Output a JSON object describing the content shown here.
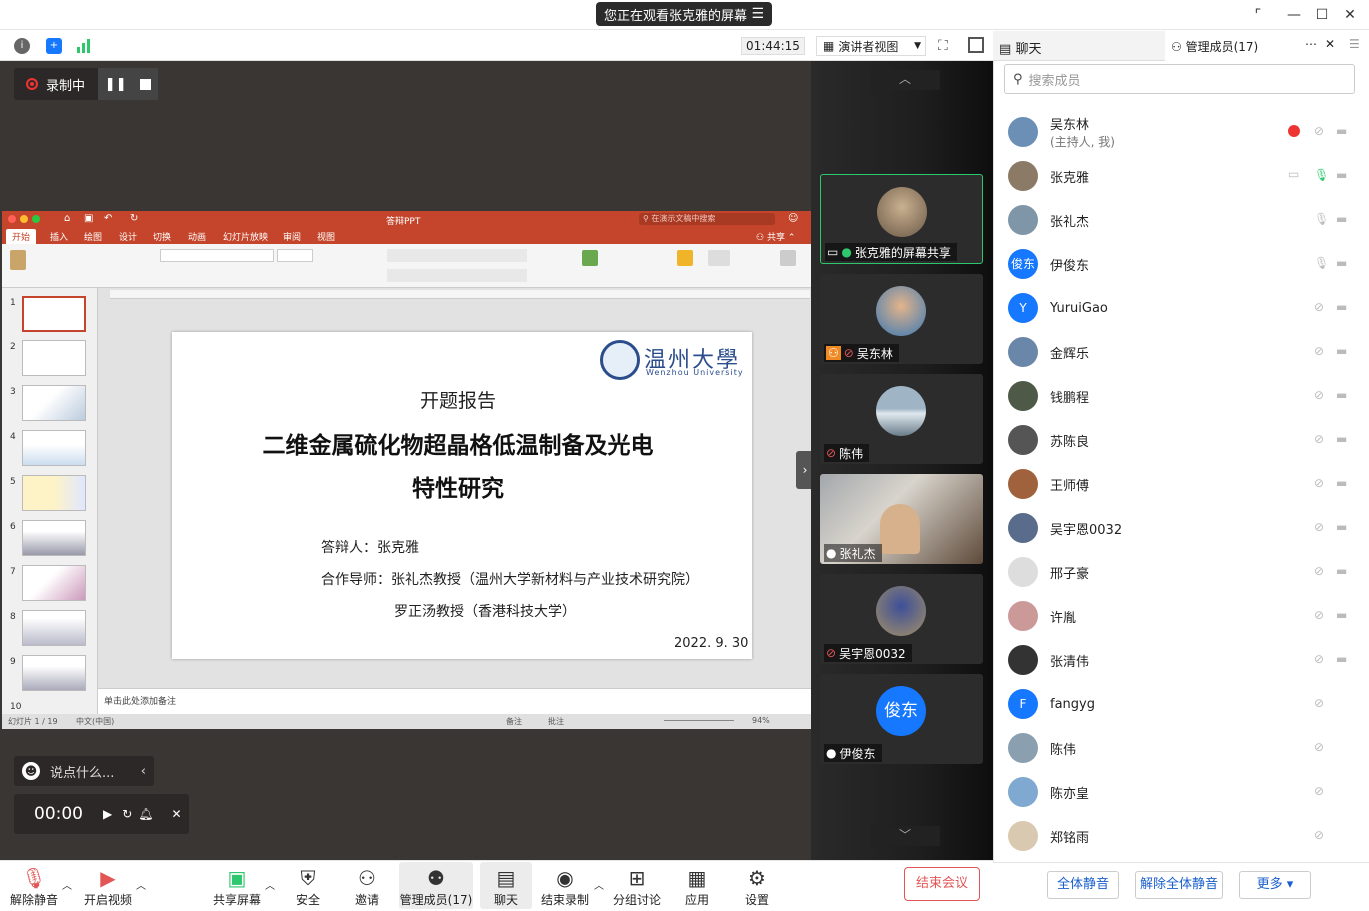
{
  "title_bar": {
    "share_banner": "您正在观看张克雅的屏幕"
  },
  "toolbar": {
    "timer": "01:44:15",
    "speaker_view": "演讲者视图"
  },
  "recording": {
    "label": "录制中"
  },
  "ppt": {
    "window_title": "答辩PPT",
    "search_placeholder": "在演示文稿中搜索",
    "tabs": [
      "开始",
      "插入",
      "绘图",
      "设计",
      "切换",
      "动画",
      "幻灯片放映",
      "审阅",
      "视图"
    ],
    "share": "共享",
    "notes": "单击此处添加备注",
    "status_left": "幻灯片 1 / 19",
    "status_lang": "中文(中国)",
    "status_notes": "备注",
    "status_comments": "批注",
    "zoom": "94%",
    "slide": {
      "logo_cn": "温州大學",
      "logo_en": "Wenzhou University",
      "heading": "开题报告",
      "title_line1": "二维金属硫化物超晶格低温制备及光电",
      "title_line2": "特性研究",
      "presenter": "答辩人：张克雅",
      "advisor1": "合作导师：张礼杰教授（温州大学新材料与产业技术研究院）",
      "advisor2": "罗正汤教授（香港科技大学）",
      "date": "2022. 9. 30"
    },
    "thumb_numbers": [
      "1",
      "2",
      "3",
      "4",
      "5",
      "6",
      "7",
      "8",
      "9",
      "10"
    ]
  },
  "chat_input": {
    "placeholder": "说点什么..."
  },
  "player": {
    "time": "00:00"
  },
  "video_tiles": [
    {
      "name": "张克雅的屏幕共享"
    },
    {
      "name": "吴东林"
    },
    {
      "name": "陈伟"
    },
    {
      "name": "张礼杰"
    },
    {
      "name": "吴宇恩0032"
    },
    {
      "name": "伊俊东",
      "avatar_text": "俊东"
    }
  ],
  "right_panel": {
    "tab_chat": "聊天",
    "tab_members": "管理成员(17)",
    "search_placeholder": "搜索成员",
    "members": [
      {
        "name": "吴东林",
        "sub": "(主持人, 我)",
        "color": "#6b8fb5"
      },
      {
        "name": "张克雅",
        "sub": "",
        "color": "#8a7a66"
      },
      {
        "name": "张礼杰",
        "sub": "",
        "color": "#7f95a8"
      },
      {
        "name": "伊俊东",
        "sub": "",
        "color": "#1677ff",
        "avatar_text": "俊东"
      },
      {
        "name": "YuruiGao",
        "sub": "",
        "color": "#1677ff",
        "avatar_text": "Y"
      },
      {
        "name": "金辉乐",
        "sub": "",
        "color": "#6a86a9"
      },
      {
        "name": "钱鹏程",
        "sub": "",
        "color": "#4e5a47"
      },
      {
        "name": "苏陈良",
        "sub": "",
        "color": "#555"
      },
      {
        "name": "王师傅",
        "sub": "",
        "color": "#a0623c"
      },
      {
        "name": "吴宇恩0032",
        "sub": "",
        "color": "#596c8c"
      },
      {
        "name": "邢子豪",
        "sub": "",
        "color": "#ddd"
      },
      {
        "name": "许胤",
        "sub": "",
        "color": "#c99"
      },
      {
        "name": "张清伟",
        "sub": "",
        "color": "#333"
      },
      {
        "name": "fangyg",
        "sub": "",
        "color": "#1677ff",
        "avatar_text": "F"
      },
      {
        "name": "陈伟",
        "sub": "",
        "color": "#8aa0b0"
      },
      {
        "name": "陈亦皇",
        "sub": "",
        "color": "#7fa9d0"
      },
      {
        "name": "郑铭雨",
        "sub": "",
        "color": "#d8c9b0"
      }
    ],
    "footer": {
      "mute_all": "全体静音",
      "unmute_all": "解除全体静音",
      "more": "更多"
    }
  },
  "bottom_bar": {
    "unmute": "解除静音",
    "start_video": "开启视频",
    "share_screen": "共享屏幕",
    "security": "安全",
    "invite": "邀请",
    "manage_members": "管理成员(17)",
    "chat": "聊天",
    "end_recording": "结束录制",
    "breakout": "分组讨论",
    "apps": "应用",
    "settings": "设置",
    "end_meeting": "结束会议"
  },
  "colors": {
    "accent": "#1677ff",
    "danger": "#e25656",
    "active_border": "#2ec76e",
    "ppt_red": "#c4452b"
  }
}
